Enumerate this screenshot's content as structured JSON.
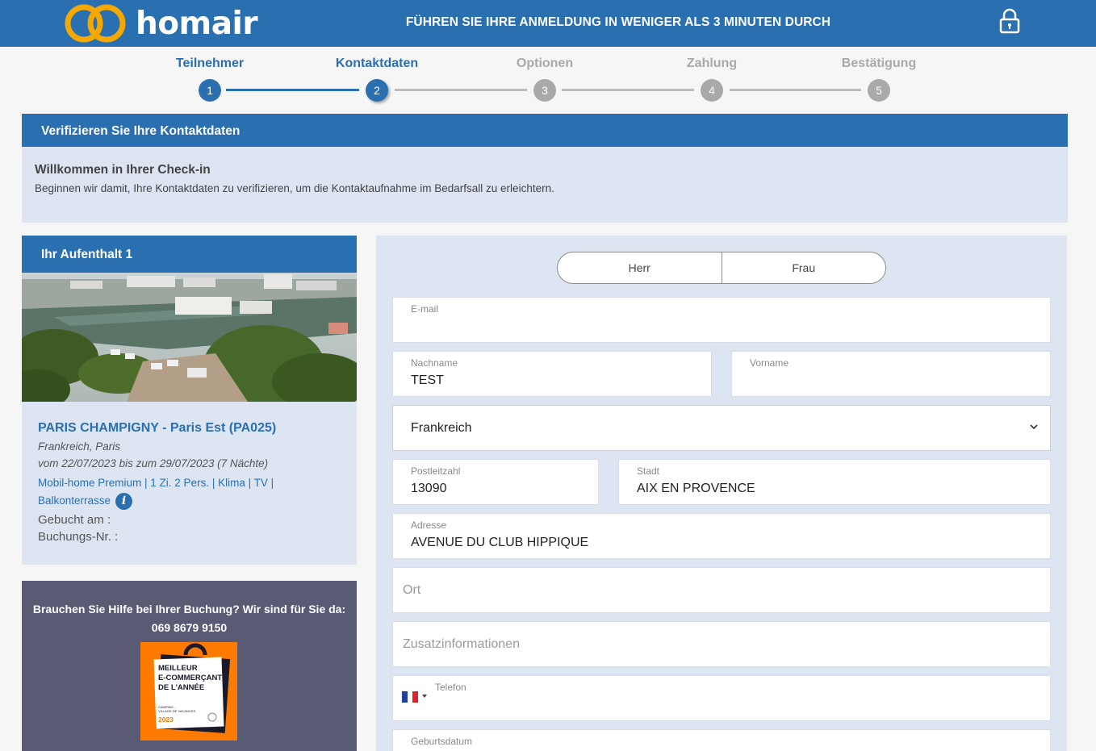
{
  "header": {
    "brand": "homair",
    "title": "FÜHREN SIE IHRE ANMELDUNG IN WENIGER ALS 3 MINUTEN DURCH",
    "brand_color": "#2a6fb0",
    "logo_color": "#f5a800",
    "lock_icon": "lock-icon"
  },
  "steps": [
    {
      "label": "Teilnehmer",
      "number": "1",
      "state": "done"
    },
    {
      "label": "Kontaktdaten",
      "number": "2",
      "state": "current"
    },
    {
      "label": "Optionen",
      "number": "3",
      "state": "todo"
    },
    {
      "label": "Zahlung",
      "number": "4",
      "state": "todo"
    },
    {
      "label": "Bestätigung",
      "number": "5",
      "state": "todo"
    }
  ],
  "verify": {
    "title": "Verifizieren Sie Ihre Kontaktdaten",
    "welcome_title": "Willkommen in Ihrer Check-in",
    "welcome_text": "Beginnen wir damit, Ihre Kontaktdaten zu verifizieren, um die Kontaktaufnahme im Bedarfsall zu erleichtern."
  },
  "stay": {
    "title": "Ihr Aufenthalt 1",
    "camp_name": "PARIS CHAMPIGNY - Paris Est (PA025)",
    "location": "Frankreich, Paris",
    "dates": "vom 22/07/2023 bis zum 29/07/2023 (7 Nächte)",
    "accommodation_line1": "Mobil-home Premium | 1 Zi. 2 Pers. | Klima | TV |",
    "accommodation_line2": "Balkonterrasse",
    "booked_label": "Gebucht am :",
    "booking_nr_label": "Buchungs-Nr. :"
  },
  "help": {
    "text": "Brauchen Sie Hilfe bei Ihrer Buchung? Wir sind für Sie da:",
    "phone": "069 8679 9150",
    "badge_line1": "MEILLEUR",
    "badge_line2": "E-COMMERÇANT",
    "badge_line3": "DE L'ANNÉE",
    "badge_small1": "CAMPING -",
    "badge_small2": "VILLAGE DE VACANCES",
    "badge_year": "2023",
    "badge_color": "#ff7a00"
  },
  "form": {
    "salutation": {
      "option1": "Herr",
      "option2": "Frau"
    },
    "email": {
      "label": "E-mail",
      "value": ""
    },
    "lastname": {
      "label": "Nachname",
      "value": "TEST"
    },
    "firstname": {
      "label": "Vorname",
      "value": ""
    },
    "country": {
      "value": "Frankreich"
    },
    "postcode": {
      "label": "Postleitzahl",
      "value": "13090"
    },
    "city": {
      "label": "Stadt",
      "value": "AIX EN PROVENCE"
    },
    "address": {
      "label": "Adresse",
      "value": "AVENUE DU CLUB HIPPIQUE"
    },
    "place": {
      "placeholder": "Ort"
    },
    "additional": {
      "placeholder": "Zusatzinformationen"
    },
    "phone": {
      "label": "Telefon",
      "value": ""
    },
    "birthdate": {
      "label": "Geburtsdatum"
    }
  }
}
